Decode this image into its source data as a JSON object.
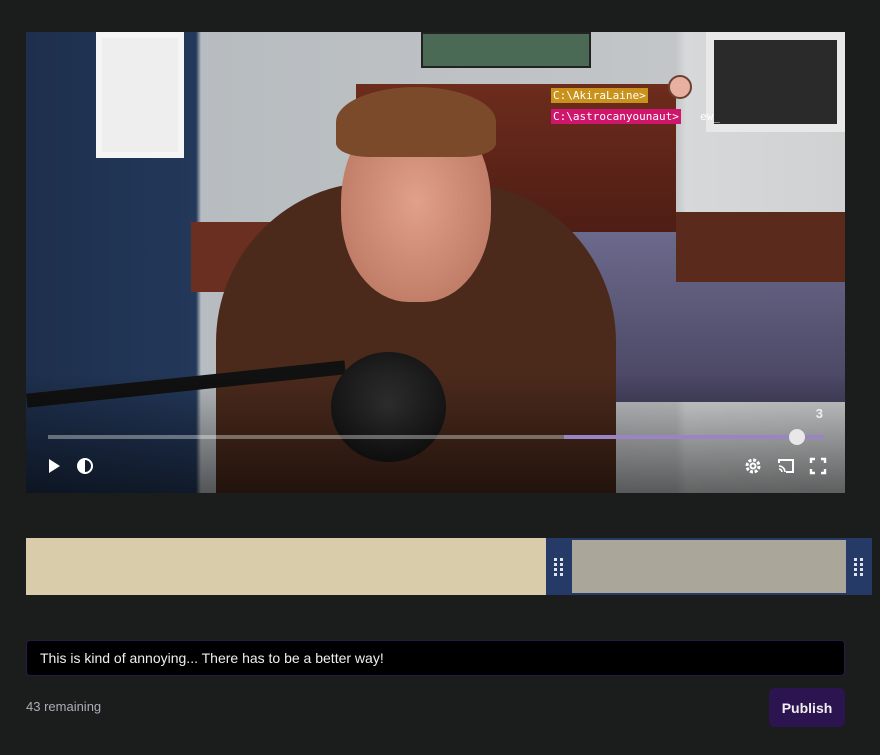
{
  "video": {
    "overlay_chat": [
      {
        "user": "C:\\AkiraLaine>",
        "message": ""
      },
      {
        "user": "C:\\astrocanyounaut>",
        "message": "ew_"
      }
    ],
    "playback_count": "3",
    "played_fraction": 0.965,
    "buffered_from_fraction": 0.665,
    "controls": {
      "play": "play-icon",
      "volume": "volume-icon",
      "settings": "gear-icon",
      "cast": "cast-icon",
      "fullscreen": "fullscreen-icon"
    },
    "accent_color": "#9b84c4"
  },
  "timeline": {
    "selection_start_fraction": 0.615,
    "selection_end_fraction": 1.0,
    "handle_color": "#253a66"
  },
  "title_input": {
    "value": "This is kind of annoying... There has to be a better way!"
  },
  "remaining_label": "43 remaining",
  "publish_label": "Publish"
}
